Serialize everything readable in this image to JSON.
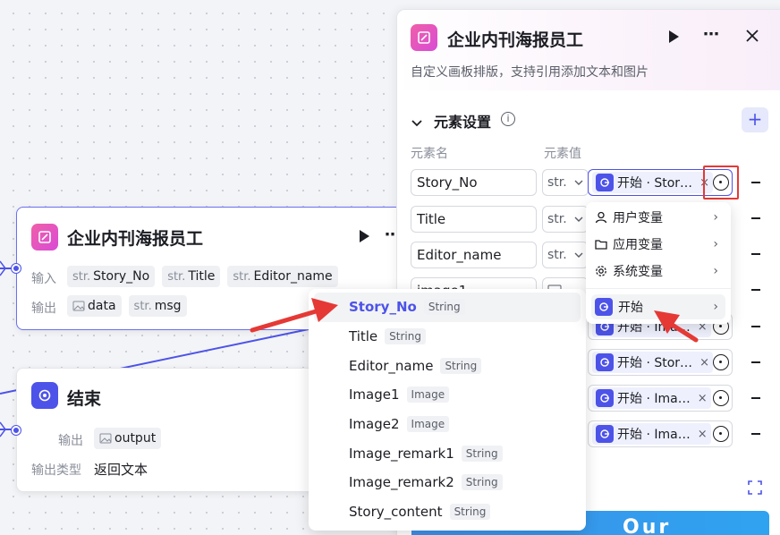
{
  "canvas": {
    "node_main": {
      "title": "企业内刊海报员工",
      "input_label": "输入",
      "output_label": "输出",
      "inputs": [
        {
          "prefix": "str.",
          "name": "Story_No"
        },
        {
          "prefix": "str.",
          "name": "Title"
        },
        {
          "prefix": "str.",
          "name": "Editor_name"
        }
      ],
      "outputs": [
        {
          "prefix": "image",
          "name": "data"
        },
        {
          "prefix": "str.",
          "name": "msg"
        }
      ]
    },
    "node_end": {
      "title": "结束",
      "output_label": "输出",
      "output_name": "output",
      "output_type_label": "输出类型",
      "output_type_value": "返回文本"
    }
  },
  "panel": {
    "title": "企业内刊海报员工",
    "description": "自定义画板排版，支持引用添加文本和图片",
    "section_title": "元素设置",
    "col_name": "元素名",
    "col_value": "元素值",
    "rows": [
      {
        "name": "Story_No",
        "type": "str.",
        "ref": "开始 · Stor…"
      },
      {
        "name": "Title",
        "type": "str.",
        "ref": ""
      },
      {
        "name": "Editor_name",
        "type": "str.",
        "ref": ""
      },
      {
        "name": "image1",
        "type": "img",
        "ref": ""
      },
      {
        "name": "",
        "type": "",
        "ref": "开始 · Ima…"
      },
      {
        "name": "",
        "type": "",
        "ref": "开始 · Stor…"
      },
      {
        "name": "",
        "type": "",
        "ref": "开始 · Ima…"
      },
      {
        "name": "",
        "type": "",
        "ref": "开始 · Ima…"
      }
    ],
    "banner_text": "Our stories"
  },
  "popup_menu": {
    "items": [
      {
        "label": "用户变量",
        "icon": "user-icon"
      },
      {
        "label": "应用变量",
        "icon": "folder-icon"
      },
      {
        "label": "系统变量",
        "icon": "gear-icon"
      },
      {
        "label": "开始",
        "icon": "start-node-icon"
      }
    ]
  },
  "dropdown": {
    "items": [
      {
        "name": "Story_No",
        "type": "String"
      },
      {
        "name": "Title",
        "type": "String"
      },
      {
        "name": "Editor_name",
        "type": "String"
      },
      {
        "name": "Image1",
        "type": "Image"
      },
      {
        "name": "Image2",
        "type": "Image"
      },
      {
        "name": "Image_remark1",
        "type": "String"
      },
      {
        "name": "Image_remark2",
        "type": "String"
      },
      {
        "name": "Story_content",
        "type": "String"
      }
    ]
  },
  "colors": {
    "accent": "#4d53e8",
    "brand_pink": "#e64aa0",
    "highlight_red": "#e53935",
    "selected_text": "#4d53e8"
  }
}
